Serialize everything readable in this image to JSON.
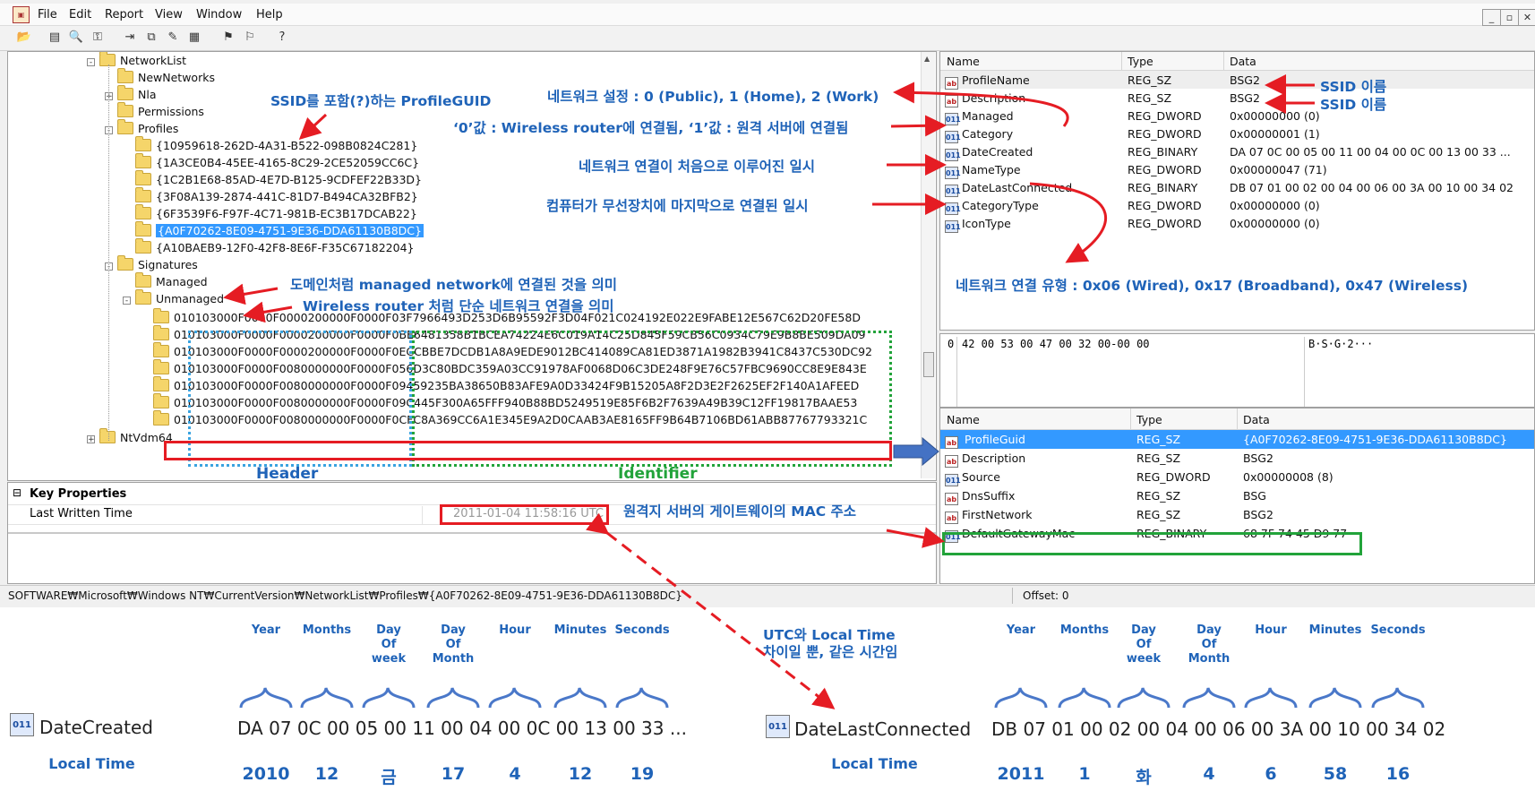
{
  "menu": [
    "File",
    "Edit",
    "Report",
    "View",
    "Window",
    "Help"
  ],
  "tree": [
    {
      "label": "NetworkList",
      "indent": 0,
      "expander": "-"
    },
    {
      "label": "NewNetworks",
      "indent": 1,
      "expander": ""
    },
    {
      "label": "Nla",
      "indent": 1,
      "expander": "+"
    },
    {
      "label": "Permissions",
      "indent": 1,
      "expander": ""
    },
    {
      "label": "Profiles",
      "indent": 1,
      "expander": "-"
    },
    {
      "label": "{10959618-262D-4A31-B522-098B0824C281}",
      "indent": 2,
      "expander": ""
    },
    {
      "label": "{1A3CE0B4-45EE-4165-8C29-2CE52059CC6C}",
      "indent": 2,
      "expander": ""
    },
    {
      "label": "{1C2B1E68-85AD-4E7D-B125-9CDFEF22B33D}",
      "indent": 2,
      "expander": ""
    },
    {
      "label": "{3F08A139-2874-441C-81D7-B494CA32BFB2}",
      "indent": 2,
      "expander": ""
    },
    {
      "label": "{6F3539F6-F97F-4C71-981B-EC3B17DCAB22}",
      "indent": 2,
      "expander": ""
    },
    {
      "label": "{A0F70262-8E09-4751-9E36-DDA61130B8DC}",
      "indent": 2,
      "expander": "",
      "selected": true
    },
    {
      "label": "{A10BAEB9-12F0-42F8-8E6F-F35C67182204}",
      "indent": 2,
      "expander": ""
    },
    {
      "label": "Signatures",
      "indent": 1,
      "expander": "-"
    },
    {
      "label": "Managed",
      "indent": 2,
      "expander": ""
    },
    {
      "label": "Unmanaged",
      "indent": 2,
      "expander": "-"
    },
    {
      "label": "010103000F0000F0000200000F0000F03F7966493D253D6B95592F3D04F021C024192E022E9FABE12E567C62D20FE58D",
      "indent": 3,
      "expander": ""
    },
    {
      "label": "010103000F0000F0000200000F0000F0BE6481358B1BCEA74224E6C019A14C25D845F59CB56C0934C79E9B8BE509DA09",
      "indent": 3,
      "expander": ""
    },
    {
      "label": "010103000F0000F0000200000F0000F0ECCBBE7DCDB1A8A9EDE9012BC414089CA81ED3871A1982B3941C8437C530DC92",
      "indent": 3,
      "expander": ""
    },
    {
      "label": "010103000F0000F0080000000F0000F056D3C80BDC359A03CC91978AF0068D06C3DE248F9E76C57FBC9690CC8E9E843E",
      "indent": 3,
      "expander": ""
    },
    {
      "label": "010103000F0000F0080000000F0000F09459235BA38650B83AFE9A0D33424F9B15205A8F2D3E2F2625EF2F140A1AFEED",
      "indent": 3,
      "expander": ""
    },
    {
      "label": "010103000F0000F0080000000F0000F09C445F300A65FFF940B88BD5249519E85F6B2F7639A49B39C12FF19817BAAE53",
      "indent": 3,
      "expander": ""
    },
    {
      "label": "010103000F0000F0080000000F0000F0CFC8A369CC6A1E345E9A2D0CAAB3AE8165FF9B64B7106BD61ABB87767793321C",
      "indent": 3,
      "expander": ""
    },
    {
      "label": "NtVdm64",
      "indent": 0,
      "expander": "+"
    }
  ],
  "grid_headers": {
    "name": "Name",
    "type": "Type",
    "data": "Data"
  },
  "values_top": [
    {
      "name": "ProfileName",
      "type": "REG_SZ",
      "data": "BSG2",
      "icon": "ab"
    },
    {
      "name": "Description",
      "type": "REG_SZ",
      "data": "BSG2",
      "icon": "ab"
    },
    {
      "name": "Managed",
      "type": "REG_DWORD",
      "data": "0x00000000 (0)",
      "icon": "bin"
    },
    {
      "name": "Category",
      "type": "REG_DWORD",
      "data": "0x00000001 (1)",
      "icon": "bin"
    },
    {
      "name": "DateCreated",
      "type": "REG_BINARY",
      "data": "DA 07 0C 00 05 00 11 00 04 00 0C 00 13 00 33 ...",
      "icon": "bin"
    },
    {
      "name": "NameType",
      "type": "REG_DWORD",
      "data": "0x00000047 (71)",
      "icon": "bin"
    },
    {
      "name": "DateLastConnected",
      "type": "REG_BINARY",
      "data": "DB 07 01 00 02 00 04 00 06 00 3A 00 10 00 34 02",
      "icon": "bin"
    },
    {
      "name": "CategoryType",
      "type": "REG_DWORD",
      "data": "0x00000000 (0)",
      "icon": "bin"
    },
    {
      "name": "IconType",
      "type": "REG_DWORD",
      "data": "0x00000000 (0)",
      "icon": "bin"
    }
  ],
  "hex": {
    "offset": "0",
    "bytes": "42 00 53 00 47 00 32 00-00 00",
    "ascii": "B·S·G·2···"
  },
  "values_bottom": [
    {
      "name": "ProfileGuid",
      "type": "REG_SZ",
      "data": "{A0F70262-8E09-4751-9E36-DDA61130B8DC}",
      "icon": "ab"
    },
    {
      "name": "Description",
      "type": "REG_SZ",
      "data": "BSG2",
      "icon": "ab"
    },
    {
      "name": "Source",
      "type": "REG_DWORD",
      "data": "0x00000008 (8)",
      "icon": "bin"
    },
    {
      "name": "DnsSuffix",
      "type": "REG_SZ",
      "data": "BSG",
      "icon": "ab"
    },
    {
      "name": "FirstNetwork",
      "type": "REG_SZ",
      "data": "BSG2",
      "icon": "ab"
    },
    {
      "name": "DefaultGatewayMac",
      "type": "REG_BINARY",
      "data": "68 7F 74 45 D9 77",
      "icon": "bin"
    }
  ],
  "key_properties": {
    "title": "Key Properties",
    "label": "Last Written Time",
    "value": "2011-01-04 11:58:16 UTC"
  },
  "status": {
    "path": "SOFTWARE₩Microsoft₩Windows NT₩CurrentVersion₩NetworkList₩Profiles₩{A0F70262-8E09-4751-9E36-DDA61130B8DC}",
    "offset": "Offset: 0"
  },
  "annotations": {
    "ssid_guid": "SSID를 포함(?)하는 ProfileGUID",
    "category": "네트워크 설정 : 0 (Public), 1 (Home), 2 (Work)",
    "managed": "‘0’값 : Wireless router에 연결됨, ‘1’값 : 원격 서버에 연결됨",
    "date_created": "네트워크 연결이 처음으로 이루어진 일시",
    "date_last": "컴퓨터가 무선장치에 마지막으로 연결된 일시",
    "ssid1": "SSID 이름",
    "ssid2": "SSID 이름",
    "name_type": "네트워크 연결 유형 : 0x06 (Wired), 0x17 (Broadband), 0x47 (Wireless)",
    "sig_managed": "도메인처럼 managed network에 연결된 것을 의미",
    "sig_unmanaged": "Wireless router 처럼 단순 네트워크 연결을 의미",
    "gateway": "원격지 서버의 게이트웨이의 MAC 주소",
    "header": "Header",
    "identifier": "Identifier",
    "utc_line1": "UTC와 Local Time",
    "utc_line2": "차이일 뿐, 같은 시간임"
  },
  "bottom": {
    "left_name": "DateCreated",
    "left_hex": "DA 07 0C 00 05 00 11 00 04 00 0C 00 13 00 33 ...",
    "left_caption": "Local Time",
    "left_labels": [
      "Year",
      "Months",
      "Day\nOf\nweek",
      "Day\nOf\nMonth",
      "Hour",
      "Minutes",
      "Seconds"
    ],
    "left_values": [
      "2010",
      "12",
      "금",
      "17",
      "4",
      "12",
      "19"
    ],
    "right_name": "DateLastConnected",
    "right_hex": "DB 07 01 00 02 00 04 00 06 00 3A 00 10 00 34 02",
    "right_caption": "Local Time",
    "right_labels": [
      "Year",
      "Months",
      "Day\nOf\nweek",
      "Day\nOf\nMonth",
      "Hour",
      "Minutes",
      "Seconds"
    ],
    "right_values": [
      "2011",
      "1",
      "화",
      "4",
      "6",
      "58",
      "16"
    ]
  },
  "colors": {
    "annotation": "#1f63b8",
    "arrow_red": "#e51c23",
    "box_green": "#22a33a",
    "box_blue": "#3aa3e0",
    "selection": "#3399ff"
  }
}
